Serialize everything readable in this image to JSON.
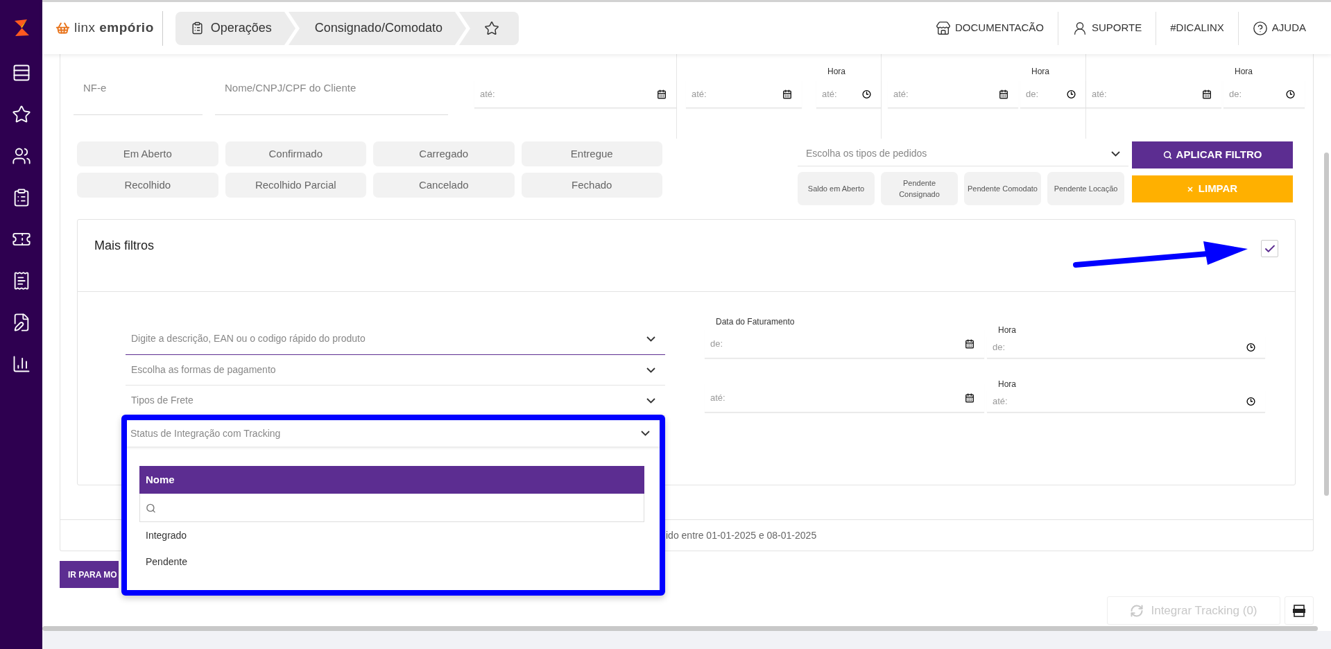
{
  "header": {
    "brand": "linx **empório**",
    "breadcrumbs": [
      {
        "label": "Operações"
      },
      {
        "label": "Consignado/Comodato"
      }
    ],
    "links": [
      {
        "label": "DOCUMENTACÃO"
      },
      {
        "label": "SUPORTE"
      },
      {
        "label": "#DICALINX"
      },
      {
        "label": "AJUDA"
      }
    ]
  },
  "filters": {
    "nfe": {
      "placeholder": "NF-e"
    },
    "client": {
      "placeholder": "Nome/CNPJ/CPF do Cliente"
    },
    "period_fields": [
      {
        "kind": "date",
        "placeholder": "até:"
      },
      {
        "kind": "date",
        "placeholder": "até:"
      },
      {
        "kind": "time",
        "label": "Hora",
        "placeholder": "até:"
      },
      {
        "kind": "date",
        "placeholder": "até:"
      },
      {
        "kind": "time",
        "label": "Hora",
        "placeholder": "de:"
      },
      {
        "kind": "date",
        "placeholder": "até:"
      },
      {
        "kind": "time",
        "label": "Hora",
        "placeholder": "de:"
      }
    ],
    "status_buttons": [
      "Em Aberto",
      "Confirmado",
      "Carregado",
      "Entregue",
      "Recolhido",
      "Recolhido Parcial",
      "Cancelado",
      "Fechado"
    ],
    "order_type_select": {
      "placeholder": "Escolha os tipos de pedidos"
    },
    "order_types": [
      "Saldo em Aberto",
      "Pendente Consignado",
      "Pendente Comodato",
      "Pendente Locação"
    ],
    "apply_button": "APLICAR FILTRO",
    "clear_button": "LIMPAR"
  },
  "more_filters": {
    "title": "Mais filtros",
    "checked": true,
    "selects": [
      {
        "placeholder": "Digite a descrição, EAN ou o codigo rápido do produto",
        "focused": true
      },
      {
        "placeholder": "Escolha as formas de pagamento",
        "focused": false
      },
      {
        "placeholder": "Tipos de Frete",
        "focused": false
      }
    ],
    "billing_date": {
      "label": "Data do Faturamento",
      "fields": [
        {
          "placeholder": "de:"
        },
        {
          "placeholder": "até:"
        }
      ]
    },
    "times": [
      {
        "label": "Hora",
        "placeholder": "de:"
      },
      {
        "label": "Hora",
        "placeholder": "até:"
      }
    ]
  },
  "footer_text": "ido entre 01-01-2025 e 08-01-2025",
  "goto_button": "IR PARA MO",
  "integrate_button": {
    "label": "Integrar Tracking (0)",
    "disabled": true
  },
  "tracking_dropdown": {
    "select": "Status de Integração com Tracking",
    "column_header": "Nome",
    "options": [
      "Integrado",
      "Pendente"
    ]
  }
}
